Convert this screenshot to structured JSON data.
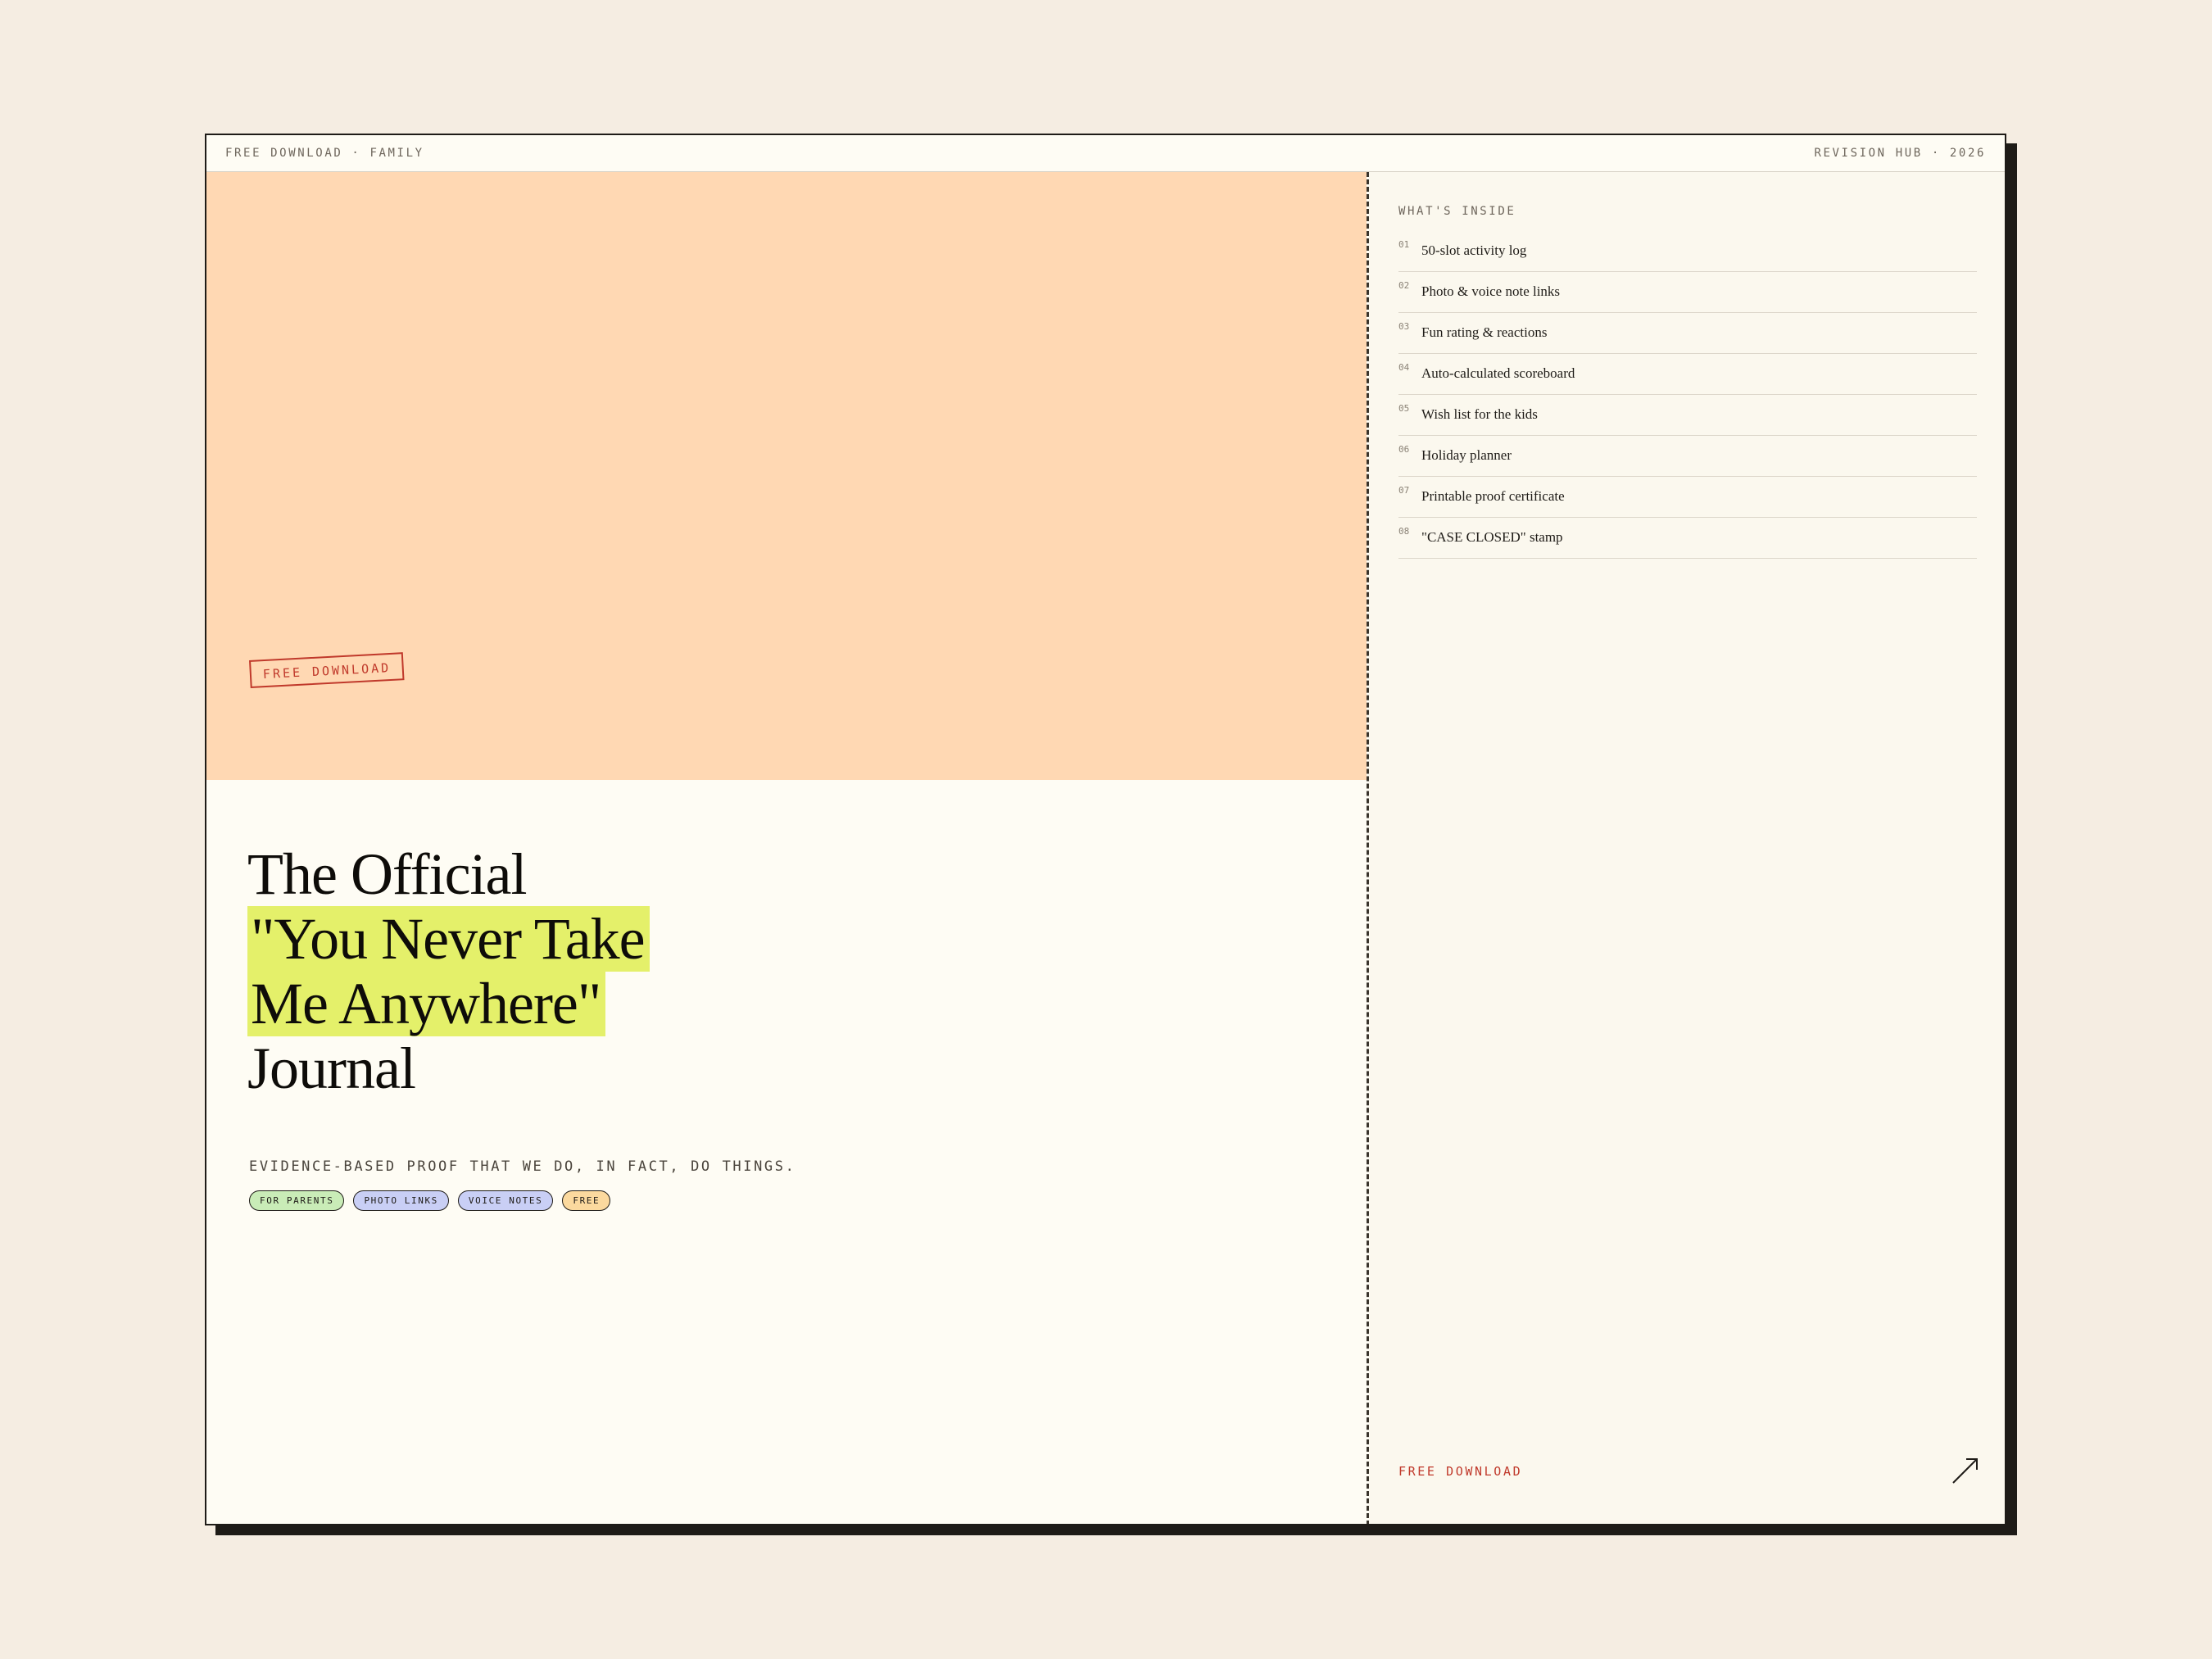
{
  "topbar": {
    "left": "FREE DOWNLOAD · FAMILY",
    "right": "REVISION HUB · 2026"
  },
  "hero": {
    "stamp": "FREE DOWNLOAD",
    "title_lines": [
      "The Official",
      "\"You Never Take",
      "Me Anywhere\"",
      "Journal"
    ],
    "subtitle": "EVIDENCE-BASED PROOF THAT WE DO, IN FACT, DO THINGS.",
    "tags": [
      {
        "label": "FOR PARENTS",
        "color": "#c9ecb7"
      },
      {
        "label": "PHOTO LINKS",
        "color": "#c9cff5"
      },
      {
        "label": "VOICE NOTES",
        "color": "#c9cff5"
      },
      {
        "label": "FREE",
        "color": "#fbd99e"
      }
    ]
  },
  "sidebar": {
    "heading": "WHAT'S INSIDE",
    "items": [
      {
        "num": "01",
        "label": "50-slot activity log"
      },
      {
        "num": "02",
        "label": "Photo & voice note links"
      },
      {
        "num": "03",
        "label": "Fun rating & reactions"
      },
      {
        "num": "04",
        "label": "Auto-calculated scoreboard"
      },
      {
        "num": "05",
        "label": "Wish list for the kids"
      },
      {
        "num": "06",
        "label": "Holiday planner"
      },
      {
        "num": "07",
        "label": "Printable proof certificate"
      },
      {
        "num": "08",
        "label": "\"CASE CLOSED\" stamp"
      }
    ],
    "cta": "FREE DOWNLOAD",
    "cta_icon": "arrow-up-right-icon"
  },
  "colors": {
    "hero_bg": "#ffd8b3",
    "highlight": "#e4f06a",
    "accent_red": "#c0392b",
    "page_bg": "#f5ede2"
  }
}
